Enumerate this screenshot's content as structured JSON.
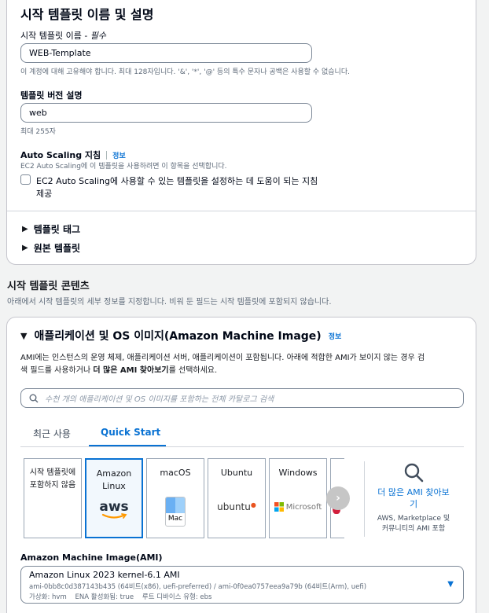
{
  "details": {
    "heading": "시작 템플릿 이름 및 설명",
    "name_label": "시작 템플릿 이름 - ",
    "name_required": "필수",
    "name_value": "WEB-Template",
    "name_hint": "이 계정에 대해 고유해야 합니다. 최대 128자입니다. '&', '*', '@' 등의 특수 문자나 공백은 사용할 수 없습니다.",
    "version_label": "템플릿 버전 설명",
    "version_value": "web",
    "version_hint": "최대 255자",
    "asg_label": "Auto Scaling 지침",
    "asg_info": "정보",
    "asg_desc": "EC2 Auto Scaling에 이 템플릿을 사용하려면 이 항목을 선택합니다.",
    "asg_checkbox_line1": "EC2 Auto Scaling에 사용할 수 있는 템플릿을 설정하는 데 도움이 되는 지침",
    "asg_checkbox_line2": "제공",
    "tags_label": "템플릿 태그",
    "source_label": "원본 템플릿"
  },
  "contents": {
    "heading": "시작 템플릿 콘텐츠",
    "desc": "아래에서 시작 템플릿의 세부 정보를 지정합니다. 비워 둔 필드는 시작 템플릿에 포함되지 않습니다."
  },
  "ami_section": {
    "heading": "애플리케이션 및 OS 이미지(Amazon Machine Image)",
    "info": "정보",
    "desc_line1": "AMI에는 인스턴스의 운영 체제, 애플리케이션 서버, 애플리케이션이 포함됩니다. 아래에 적합한 AMI가 보이지 않는 경우 검",
    "desc_line2_pre": "색 필드를 사용하거나 ",
    "desc_line2_bold": "더 많은 AMI 찾아보기",
    "desc_line2_post": "를 선택하세요.",
    "search_placeholder": "수천 개의 애플리케이션 및 OS 이미지를 포함하는 전체 카탈로그 검색",
    "tabs": [
      "최근 사용",
      "Quick Start"
    ],
    "tiles": {
      "none_line1": "시작 템플릿에",
      "none_line2": "포함하지 않음",
      "amazon_line1": "Amazon",
      "amazon_line2": "Linux",
      "amazon_logo": "aws",
      "macos": "macOS",
      "macos_logo": "Mac",
      "ubuntu": "Ubuntu",
      "ubuntu_logo": "ubuntu",
      "windows": "Windows",
      "windows_logo": "Microsoft"
    },
    "browse_line1": "더 많은 AMI 찾아보",
    "browse_line2": "기",
    "browse_sub_line1": "AWS, Marketplace 및",
    "browse_sub_line2": "커뮤니티의 AMI 포함",
    "ami_label": "Amazon Machine Image(AMI)",
    "ami_name": "Amazon Linux 2023 kernel-6.1 AMI",
    "ami_ids": "ami-0bb8c0d387143b435 (64비트(x86), uefi-preferred) / ami-0f0ea0757eea9a79b (64비트(Arm), uefi)",
    "ami_meta": "가상화: hvm    ENA 활성화됨: true    루트 디바이스 유형: ebs"
  },
  "colors": {
    "accent": "#0972d3",
    "aws_orange": "#ff9900",
    "ubuntu_orange": "#e95420"
  }
}
